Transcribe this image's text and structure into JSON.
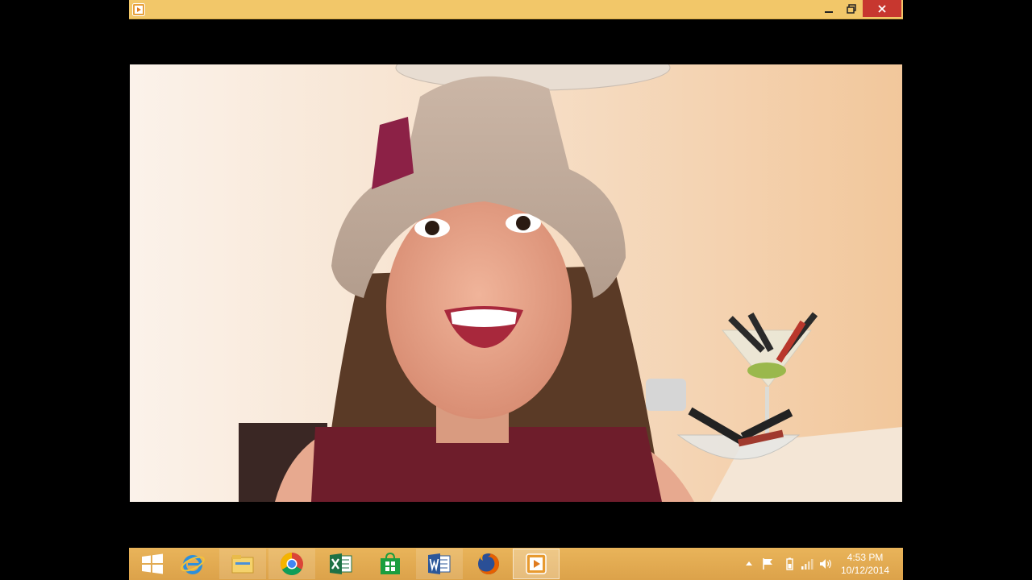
{
  "window": {
    "app_icon": "media-player-icon",
    "controls": {
      "minimize_icon": "minimize-icon",
      "maximize_icon": "restore-icon",
      "close_icon": "close-icon"
    },
    "title_bar_color": "#f2c769",
    "close_color": "#c7372f"
  },
  "taskbar": {
    "background": "#dca24a",
    "apps": [
      {
        "icon": "windows-start-icon",
        "state": "normal"
      },
      {
        "icon": "internet-explorer-icon",
        "state": "normal"
      },
      {
        "icon": "file-explorer-icon",
        "state": "open"
      },
      {
        "icon": "chrome-icon",
        "state": "open"
      },
      {
        "icon": "excel-icon",
        "state": "normal"
      },
      {
        "icon": "windows-store-icon",
        "state": "normal"
      },
      {
        "icon": "word-icon",
        "state": "open"
      },
      {
        "icon": "firefox-icon",
        "state": "normal"
      },
      {
        "icon": "media-player-icon",
        "state": "active"
      }
    ],
    "tray": {
      "icons": [
        "show-hidden-icons-icon",
        "action-center-flag-icon",
        "battery-icon",
        "network-signal-icon",
        "volume-icon"
      ],
      "time": "4:53 PM",
      "date": "10/12/2014"
    }
  }
}
